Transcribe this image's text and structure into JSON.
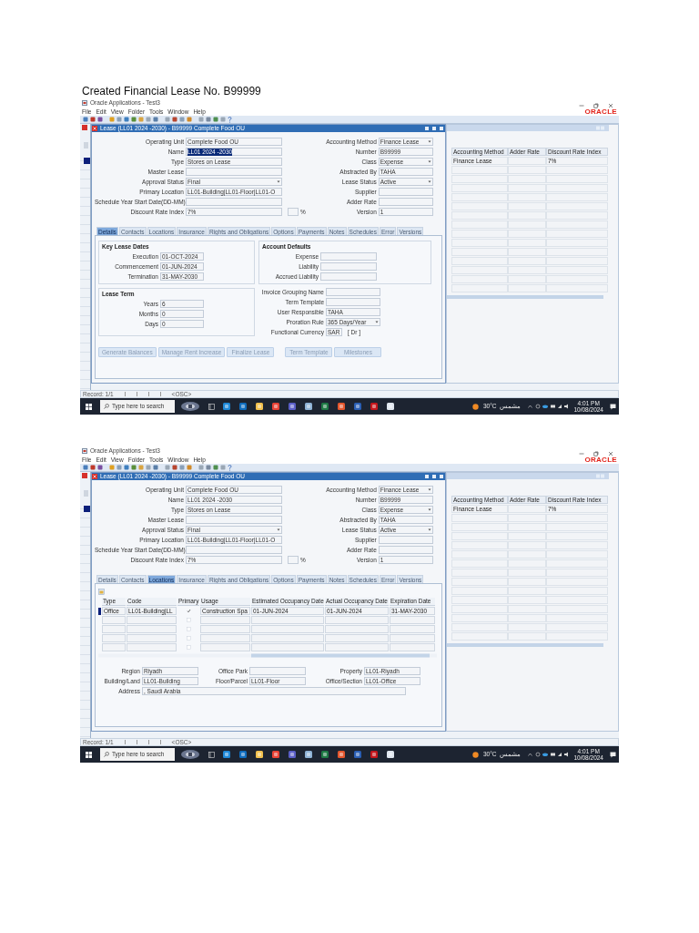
{
  "title": "Created Financial Lease No. B99999",
  "screens": [
    {
      "app_title": "Oracle Applications - Test3",
      "menu": [
        "File",
        "Edit",
        "View",
        "Folder",
        "Tools",
        "Window",
        "Help"
      ],
      "logo": "ORACLE",
      "lease_window": {
        "title": "Lease (LL01 2024 -2030) - B99999  Complete Food OU",
        "fields_left": [
          {
            "label": "Operating Unit",
            "value": "Complete Food OU",
            "kind": "text"
          },
          {
            "label": "Name",
            "value": "LL01 2024 -2030",
            "kind": "text",
            "highlighted": true
          },
          {
            "label": "Type",
            "value": "Stores on Lease",
            "kind": "text"
          },
          {
            "label": "Master Lease",
            "kind": "text"
          },
          {
            "label": "Approval Status",
            "value": "Final",
            "kind": "select"
          },
          {
            "label": "Primary Location",
            "value": "LL01-Building|LL01-Floor|LL01-O",
            "kind": "text"
          },
          {
            "label": "Schedule Year Start Date(DD-MM)",
            "kind": "text"
          },
          {
            "label": "Discount Rate Index",
            "value": "7%",
            "kind": "text",
            "unit": "%"
          }
        ],
        "fields_right": [
          {
            "label": "Accounting Method",
            "value": "Finance Lease",
            "kind": "select"
          },
          {
            "label": "Number",
            "value": "B99999",
            "kind": "text"
          },
          {
            "label": "Class",
            "value": "Expense",
            "kind": "select"
          },
          {
            "label": "Abstracted By",
            "value": "TAHA",
            "kind": "text"
          },
          {
            "label": "Lease Status",
            "value": "Active",
            "kind": "select"
          },
          {
            "label": "Supplier",
            "kind": "text"
          },
          {
            "label": "Adder Rate",
            "kind": "text"
          },
          {
            "label": "Version",
            "value": "1",
            "kind": "text"
          }
        ],
        "tabs": [
          {
            "label": "Details",
            "selected": true
          },
          {
            "label": "Contacts",
            "selected": false
          },
          {
            "label": "Locations",
            "selected": false
          },
          {
            "label": "Insurance",
            "selected": false
          },
          {
            "label": "Rights and Obligations",
            "selected": false
          },
          {
            "label": "Options",
            "selected": false
          },
          {
            "label": "Payments",
            "selected": false
          },
          {
            "label": "Notes",
            "selected": false
          },
          {
            "label": "Schedules",
            "selected": false
          },
          {
            "label": "Error",
            "selected": false
          },
          {
            "label": "Versions",
            "selected": false
          }
        ],
        "panel": {
          "kind": "details",
          "groups": [
            {
              "title": "Key Lease Dates",
              "fields": [
                {
                  "label": "Execution",
                  "value": "01-OCT-2024",
                  "kind": "text"
                },
                {
                  "label": "Commencement",
                  "value": "01-JUN-2024",
                  "kind": "text"
                },
                {
                  "label": "Termination",
                  "value": "31-MAY-2030",
                  "kind": "text"
                }
              ]
            },
            {
              "title": "Account Defaults",
              "fields": [
                {
                  "label": "Expense",
                  "kind": "text"
                },
                {
                  "label": "Liability",
                  "kind": "text"
                },
                {
                  "label": "Accrued Liability",
                  "kind": "text"
                }
              ]
            },
            {
              "title": "Lease Term",
              "fields": [
                {
                  "label": "Years",
                  "value": "6",
                  "kind": "text"
                },
                {
                  "label": "Months",
                  "value": "0",
                  "kind": "text"
                },
                {
                  "label": "Days",
                  "value": "0",
                  "kind": "text"
                }
              ]
            }
          ],
          "fields": [
            {
              "label": "Invoice Grouping Name",
              "kind": "text"
            },
            {
              "label": "Term Template",
              "kind": "text"
            },
            {
              "label": "User Responsible",
              "value": "TAHA",
              "kind": "text"
            },
            {
              "label": "Proration Rule",
              "value": "365 Days/Year",
              "kind": "select"
            },
            {
              "label": "Functional Currency",
              "value": "SAR",
              "kind": "text",
              "extra": "[ Dr ]"
            }
          ],
          "buttons": [
            {
              "label": "Generate Balances",
              "disabled": true
            },
            {
              "label": "Manage Rent Increase",
              "disabled": true
            },
            {
              "label": "Finalize Lease",
              "disabled": true
            },
            {
              "label": "Term Template",
              "disabled": true
            },
            {
              "label": "Milestones",
              "disabled": true
            }
          ]
        }
      },
      "side_window": {
        "columns": [
          "Accounting Method",
          "Adder Rate",
          "Discount Rate Index"
        ],
        "rows": [
          {
            "cells": [
              "Finance Lease",
              null,
              "7%"
            ]
          }
        ]
      },
      "status_bar": [
        "Record: 1/1",
        "<OSC>"
      ],
      "taskbar": {
        "search_placeholder": "Type here to search",
        "temperature": "30°C",
        "weather": "مشمس",
        "time": "4:01 PM",
        "date": "10/08/2024"
      }
    },
    {
      "app_title": "Oracle Applications - Test3",
      "menu": [
        "File",
        "Edit",
        "View",
        "Folder",
        "Tools",
        "Window",
        "Help"
      ],
      "logo": "ORACLE",
      "lease_window": {
        "title": "Lease (LL01 2024 -2030) - B99999  Complete Food OU",
        "fields_left": [
          {
            "label": "Operating Unit",
            "value": "Complete Food OU",
            "kind": "text"
          },
          {
            "label": "Name",
            "value": "LL01 2024 -2030",
            "kind": "text",
            "highlighted": false
          },
          {
            "label": "Type",
            "value": "Stores on Lease",
            "kind": "text"
          },
          {
            "label": "Master Lease",
            "kind": "text"
          },
          {
            "label": "Approval Status",
            "value": "Final",
            "kind": "select"
          },
          {
            "label": "Primary Location",
            "value": "LL01-Building|LL01-Floor|LL01-O",
            "kind": "text"
          },
          {
            "label": "Schedule Year Start Date(DD-MM)",
            "kind": "text"
          },
          {
            "label": "Discount Rate Index",
            "value": "7%",
            "kind": "text",
            "unit": "%"
          }
        ],
        "fields_right": [
          {
            "label": "Accounting Method",
            "value": "Finance Lease",
            "kind": "select"
          },
          {
            "label": "Number",
            "value": "B99999",
            "kind": "text"
          },
          {
            "label": "Class",
            "value": "Expense",
            "kind": "select"
          },
          {
            "label": "Abstracted By",
            "value": "TAHA",
            "kind": "text"
          },
          {
            "label": "Lease Status",
            "value": "Active",
            "kind": "select"
          },
          {
            "label": "Supplier",
            "kind": "text"
          },
          {
            "label": "Adder Rate",
            "kind": "text"
          },
          {
            "label": "Version",
            "value": "1",
            "kind": "text"
          }
        ],
        "tabs": [
          {
            "label": "Details",
            "selected": false
          },
          {
            "label": "Contacts",
            "selected": false
          },
          {
            "label": "Locations",
            "selected": true
          },
          {
            "label": "Insurance",
            "selected": false
          },
          {
            "label": "Rights and Obligations",
            "selected": false
          },
          {
            "label": "Options",
            "selected": false
          },
          {
            "label": "Payments",
            "selected": false
          },
          {
            "label": "Notes",
            "selected": false
          },
          {
            "label": "Schedules",
            "selected": false
          },
          {
            "label": "Error",
            "selected": false
          },
          {
            "label": "Versions",
            "selected": false
          }
        ],
        "panel": {
          "kind": "locations",
          "columns": [
            "Type",
            "Code",
            "Primary",
            "Usage",
            "Estimated Occupancy Date",
            "Actual Occupancy Date",
            "Expiration Date"
          ],
          "rows": [
            {
              "cells": [
                "Office",
                "LL01-Building|LL",
                "Construction Spa",
                "01-JUN-2024",
                "01-JUN-2024",
                "31-MAY-2030"
              ],
              "primary": true
            },
            {
              "primary": false
            },
            {
              "primary": false
            },
            {
              "primary": false
            },
            {
              "primary": false
            }
          ],
          "fields": [
            {
              "label": "Region",
              "value": "Riyadh",
              "kind": "text"
            },
            {
              "label": "Office Park",
              "kind": "text"
            },
            {
              "label": "Property",
              "value": "LL01-Riyadh",
              "kind": "text"
            },
            {
              "label": "Building/Land",
              "value": "LL01-Building",
              "kind": "text"
            },
            {
              "label": "Floor/Parcel",
              "value": "LL01-Floor",
              "kind": "text"
            },
            {
              "label": "Office/Section",
              "value": "LL01-Office",
              "kind": "text"
            }
          ],
          "address": {
            "label": "Address",
            "value": ", Saudi Arabia"
          }
        }
      },
      "side_window": {
        "columns": [
          "Accounting Method",
          "Adder Rate",
          "Discount Rate Index"
        ],
        "rows": [
          {
            "cells": [
              "Finance Lease",
              null,
              "7%"
            ]
          }
        ]
      },
      "status_bar": [
        "Record: 1/1",
        "<OSC>"
      ],
      "taskbar": {
        "search_placeholder": "Type here to search",
        "temperature": "30°C",
        "weather": "مشمس",
        "time": "4:01 PM",
        "date": "10/08/2024"
      }
    }
  ]
}
